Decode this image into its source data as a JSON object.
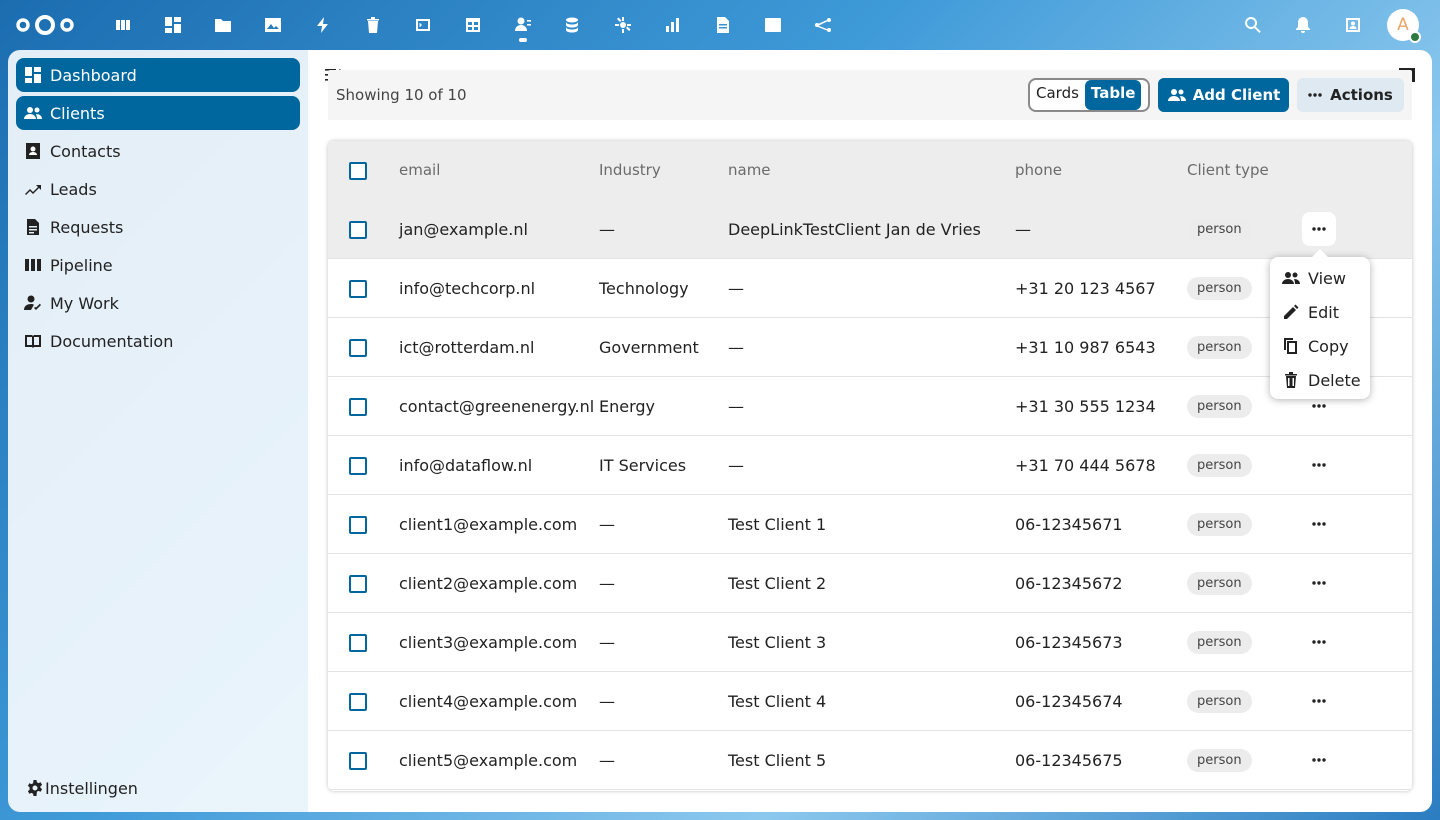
{
  "topbar": {
    "apps": [
      {
        "icon": "deck-icon"
      },
      {
        "icon": "dashboard-icon"
      },
      {
        "icon": "files-icon"
      },
      {
        "icon": "photos-icon"
      },
      {
        "icon": "activity-icon"
      },
      {
        "icon": "trash-icon"
      },
      {
        "icon": "code-icon"
      },
      {
        "icon": "tables-icon"
      },
      {
        "icon": "contacts-icon"
      },
      {
        "icon": "database-icon"
      },
      {
        "icon": "settings-bug-icon"
      },
      {
        "icon": "chart-icon"
      },
      {
        "icon": "document-icon"
      },
      {
        "icon": "image-icon"
      },
      {
        "icon": "flow-icon"
      }
    ],
    "avatar_letter": "A"
  },
  "sidebar": {
    "items": [
      {
        "label": "Dashboard",
        "icon": "dashboard-icon",
        "active": true
      },
      {
        "label": "Clients",
        "icon": "clients-icon",
        "active": true
      },
      {
        "label": "Contacts",
        "icon": "contact-card-icon",
        "active": false
      },
      {
        "label": "Leads",
        "icon": "trending-icon",
        "active": false
      },
      {
        "label": "Requests",
        "icon": "file-icon",
        "active": false
      },
      {
        "label": "Pipeline",
        "icon": "columns-icon",
        "active": false
      },
      {
        "label": "My Work",
        "icon": "user-check-icon",
        "active": false
      },
      {
        "label": "Documentation",
        "icon": "book-icon",
        "active": false
      }
    ],
    "settings_label": "Instellingen"
  },
  "header": {
    "showing": "Showing 10 of 10",
    "cards_label": "Cards",
    "table_label": "Table",
    "add_label": "Add Client",
    "actions_label": "Actions"
  },
  "table": {
    "columns": [
      "email",
      "Industry",
      "name",
      "phone",
      "Client type"
    ],
    "rows": [
      {
        "email": "jan@example.nl",
        "industry": "—",
        "name": "DeepLinkTestClient Jan de Vries",
        "phone": "—",
        "type": "person"
      },
      {
        "email": "info@techcorp.nl",
        "industry": "Technology",
        "name": "—",
        "phone": "+31 20 123 4567",
        "type": "person"
      },
      {
        "email": "ict@rotterdam.nl",
        "industry": "Government",
        "name": "—",
        "phone": "+31 10 987 6543",
        "type": "person"
      },
      {
        "email": "contact@greenenergy.nl",
        "industry": "Energy",
        "name": "—",
        "phone": "+31 30 555 1234",
        "type": "person"
      },
      {
        "email": "info@dataflow.nl",
        "industry": "IT Services",
        "name": "—",
        "phone": "+31 70 444 5678",
        "type": "person"
      },
      {
        "email": "client1@example.com",
        "industry": "—",
        "name": "Test Client 1",
        "phone": "06-12345671",
        "type": "person"
      },
      {
        "email": "client2@example.com",
        "industry": "—",
        "name": "Test Client 2",
        "phone": "06-12345672",
        "type": "person"
      },
      {
        "email": "client3@example.com",
        "industry": "—",
        "name": "Test Client 3",
        "phone": "06-12345673",
        "type": "person"
      },
      {
        "email": "client4@example.com",
        "industry": "—",
        "name": "Test Client 4",
        "phone": "06-12345674",
        "type": "person"
      },
      {
        "email": "client5@example.com",
        "industry": "—",
        "name": "Test Client 5",
        "phone": "06-12345675",
        "type": "person"
      }
    ]
  },
  "menu": {
    "items": [
      {
        "label": "View",
        "icon": "people-icon"
      },
      {
        "label": "Edit",
        "icon": "pencil-icon"
      },
      {
        "label": "Copy",
        "icon": "copy-icon"
      },
      {
        "label": "Delete",
        "icon": "trash-icon"
      }
    ]
  },
  "colors": {
    "primary": "#00679e",
    "header_bg": "#0082c9"
  }
}
